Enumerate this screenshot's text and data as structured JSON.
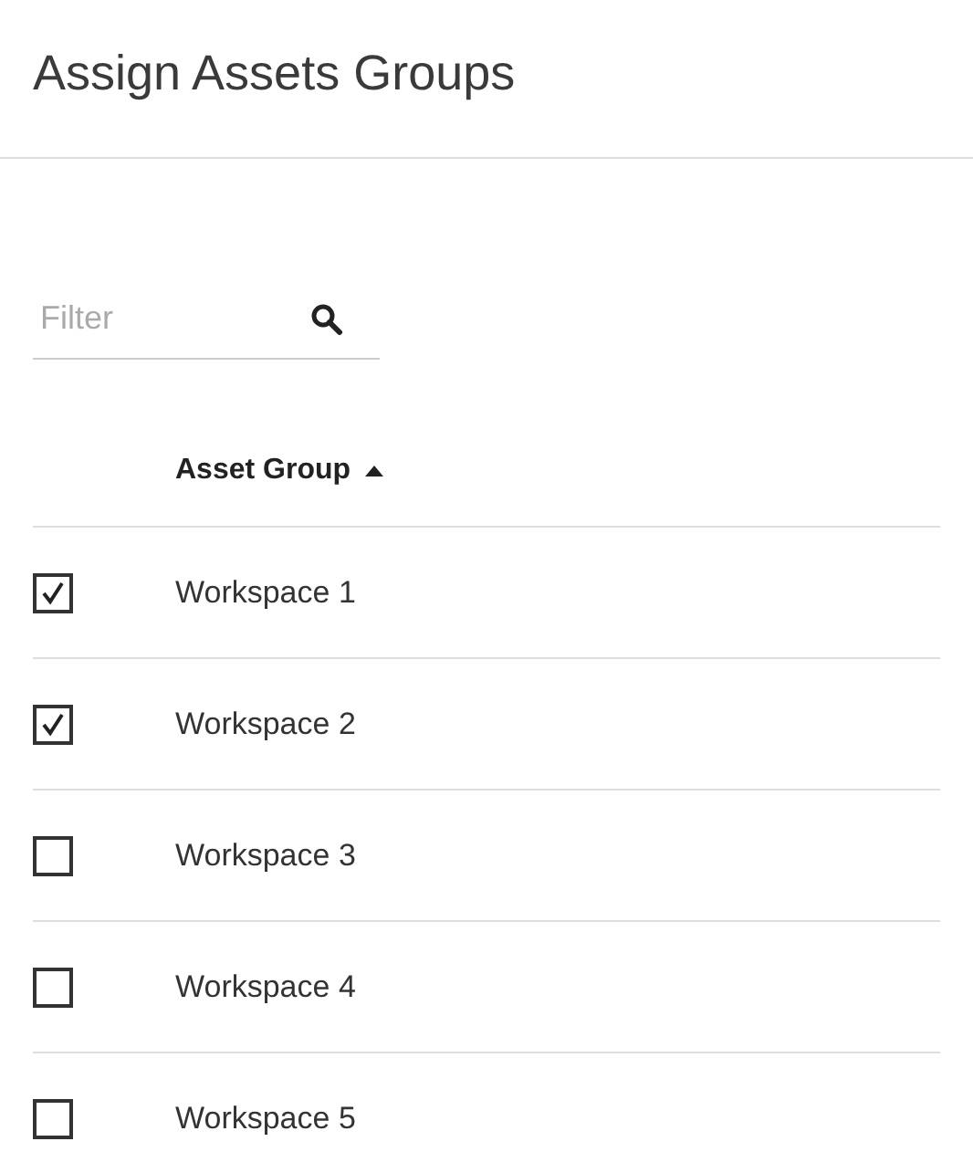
{
  "title": "Assign Assets Groups",
  "filter": {
    "placeholder": "Filter"
  },
  "table": {
    "columns": [
      {
        "label": "Asset Group",
        "sort_ascending": true
      }
    ],
    "rows": [
      {
        "name": "Workspace 1",
        "checked": true
      },
      {
        "name": "Workspace 2",
        "checked": true
      },
      {
        "name": "Workspace 3",
        "checked": false
      },
      {
        "name": "Workspace 4",
        "checked": false
      },
      {
        "name": "Workspace 5",
        "checked": false
      }
    ]
  }
}
